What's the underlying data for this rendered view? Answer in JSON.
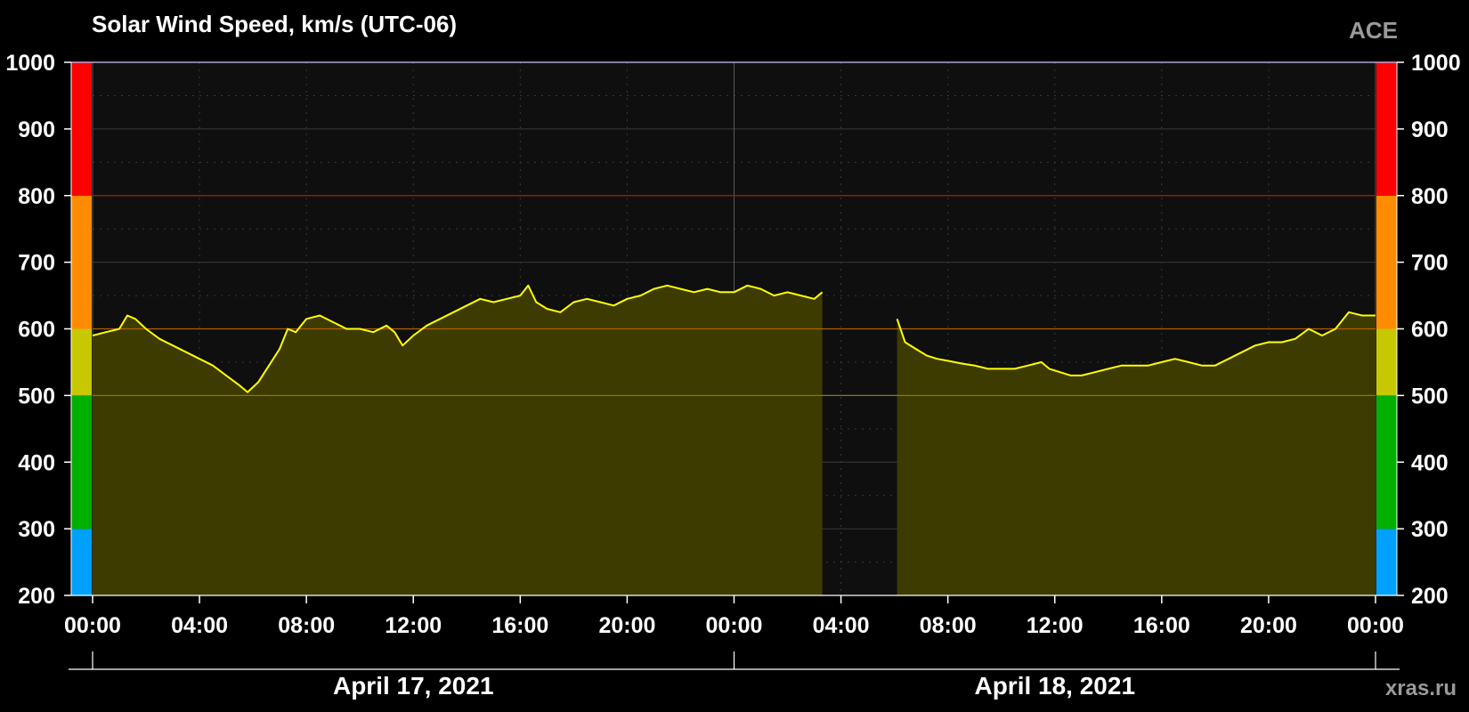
{
  "chart_data": {
    "type": "area",
    "title": "Solar Wind Speed, km/s (UTC-06)",
    "source_label": "ACE",
    "watermark": "xras.ru",
    "ylim": [
      200,
      1000
    ],
    "yticks": [
      200,
      300,
      400,
      500,
      600,
      700,
      800,
      900,
      1000
    ],
    "xlim_hours": [
      0,
      48
    ],
    "xticks": [
      {
        "h": 0,
        "label": "00:00"
      },
      {
        "h": 4,
        "label": "04:00"
      },
      {
        "h": 8,
        "label": "08:00"
      },
      {
        "h": 12,
        "label": "12:00"
      },
      {
        "h": 16,
        "label": "16:00"
      },
      {
        "h": 20,
        "label": "20:00"
      },
      {
        "h": 24,
        "label": "00:00"
      },
      {
        "h": 28,
        "label": "04:00"
      },
      {
        "h": 32,
        "label": "08:00"
      },
      {
        "h": 36,
        "label": "12:00"
      },
      {
        "h": 40,
        "label": "16:00"
      },
      {
        "h": 44,
        "label": "20:00"
      },
      {
        "h": 48,
        "label": "00:00"
      }
    ],
    "dates": [
      {
        "label": "April 17, 2021",
        "start_h": 0,
        "end_h": 24
      },
      {
        "label": "April 18, 2021",
        "start_h": 24,
        "end_h": 48
      }
    ],
    "color_bands": [
      {
        "from": 200,
        "to": 300,
        "color": "#00a0ff"
      },
      {
        "from": 300,
        "to": 500,
        "color": "#00b000"
      },
      {
        "from": 500,
        "to": 600,
        "color": "#c8c800"
      },
      {
        "from": 600,
        "to": 800,
        "color": "#ff8c00"
      },
      {
        "from": 800,
        "to": 1000,
        "color": "#ff0000"
      }
    ],
    "threshold_lines": [
      {
        "value": 500,
        "color": "#8a7a00"
      },
      {
        "value": 600,
        "color": "#b06000"
      },
      {
        "value": 800,
        "color": "#a02000"
      }
    ],
    "series": [
      {
        "line_color": "#ffff00",
        "fill_color": "#3d3b00",
        "segments": [
          [
            [
              0,
              590
            ],
            [
              0.5,
              595
            ],
            [
              1.0,
              600
            ],
            [
              1.3,
              620
            ],
            [
              1.6,
              615
            ],
            [
              2.0,
              600
            ],
            [
              2.5,
              585
            ],
            [
              3.0,
              575
            ],
            [
              3.5,
              565
            ],
            [
              4.0,
              555
            ],
            [
              4.5,
              545
            ],
            [
              5.0,
              530
            ],
            [
              5.5,
              515
            ],
            [
              5.8,
              505
            ],
            [
              6.2,
              520
            ],
            [
              6.6,
              545
            ],
            [
              7.0,
              570
            ],
            [
              7.3,
              600
            ],
            [
              7.6,
              595
            ],
            [
              8.0,
              615
            ],
            [
              8.5,
              620
            ],
            [
              9.0,
              610
            ],
            [
              9.5,
              600
            ],
            [
              10.0,
              600
            ],
            [
              10.5,
              595
            ],
            [
              11.0,
              605
            ],
            [
              11.3,
              595
            ],
            [
              11.6,
              575
            ],
            [
              12.0,
              590
            ],
            [
              12.5,
              605
            ],
            [
              13.0,
              615
            ],
            [
              13.5,
              625
            ],
            [
              14.0,
              635
            ],
            [
              14.5,
              645
            ],
            [
              15.0,
              640
            ],
            [
              15.5,
              645
            ],
            [
              16.0,
              650
            ],
            [
              16.3,
              665
            ],
            [
              16.6,
              640
            ],
            [
              17.0,
              630
            ],
            [
              17.5,
              625
            ],
            [
              18.0,
              640
            ],
            [
              18.5,
              645
            ],
            [
              19.0,
              640
            ],
            [
              19.5,
              635
            ],
            [
              20.0,
              645
            ],
            [
              20.5,
              650
            ],
            [
              21.0,
              660
            ],
            [
              21.5,
              665
            ],
            [
              22.0,
              660
            ],
            [
              22.5,
              655
            ],
            [
              23.0,
              660
            ],
            [
              23.5,
              655
            ],
            [
              24.0,
              655
            ],
            [
              24.5,
              665
            ],
            [
              25.0,
              660
            ],
            [
              25.5,
              650
            ],
            [
              26.0,
              655
            ],
            [
              26.5,
              650
            ],
            [
              27.0,
              645
            ],
            [
              27.3,
              655
            ]
          ],
          [
            [
              30.1,
              615
            ],
            [
              30.4,
              580
            ],
            [
              30.8,
              570
            ],
            [
              31.2,
              560
            ],
            [
              31.6,
              555
            ],
            [
              32.0,
              552
            ],
            [
              32.5,
              548
            ],
            [
              33.0,
              545
            ],
            [
              33.5,
              540
            ],
            [
              34.0,
              540
            ],
            [
              34.5,
              540
            ],
            [
              35.0,
              545
            ],
            [
              35.5,
              550
            ],
            [
              35.8,
              540
            ],
            [
              36.2,
              535
            ],
            [
              36.6,
              530
            ],
            [
              37.0,
              530
            ],
            [
              37.5,
              535
            ],
            [
              38.0,
              540
            ],
            [
              38.5,
              545
            ],
            [
              39.0,
              545
            ],
            [
              39.5,
              545
            ],
            [
              40.0,
              550
            ],
            [
              40.5,
              555
            ],
            [
              41.0,
              550
            ],
            [
              41.5,
              545
            ],
            [
              42.0,
              545
            ],
            [
              42.5,
              555
            ],
            [
              43.0,
              565
            ],
            [
              43.5,
              575
            ],
            [
              44.0,
              580
            ],
            [
              44.5,
              580
            ],
            [
              45.0,
              585
            ],
            [
              45.5,
              600
            ],
            [
              46.0,
              590
            ],
            [
              46.5,
              600
            ],
            [
              47.0,
              625
            ],
            [
              47.5,
              620
            ],
            [
              48.0,
              620
            ]
          ]
        ]
      }
    ]
  }
}
